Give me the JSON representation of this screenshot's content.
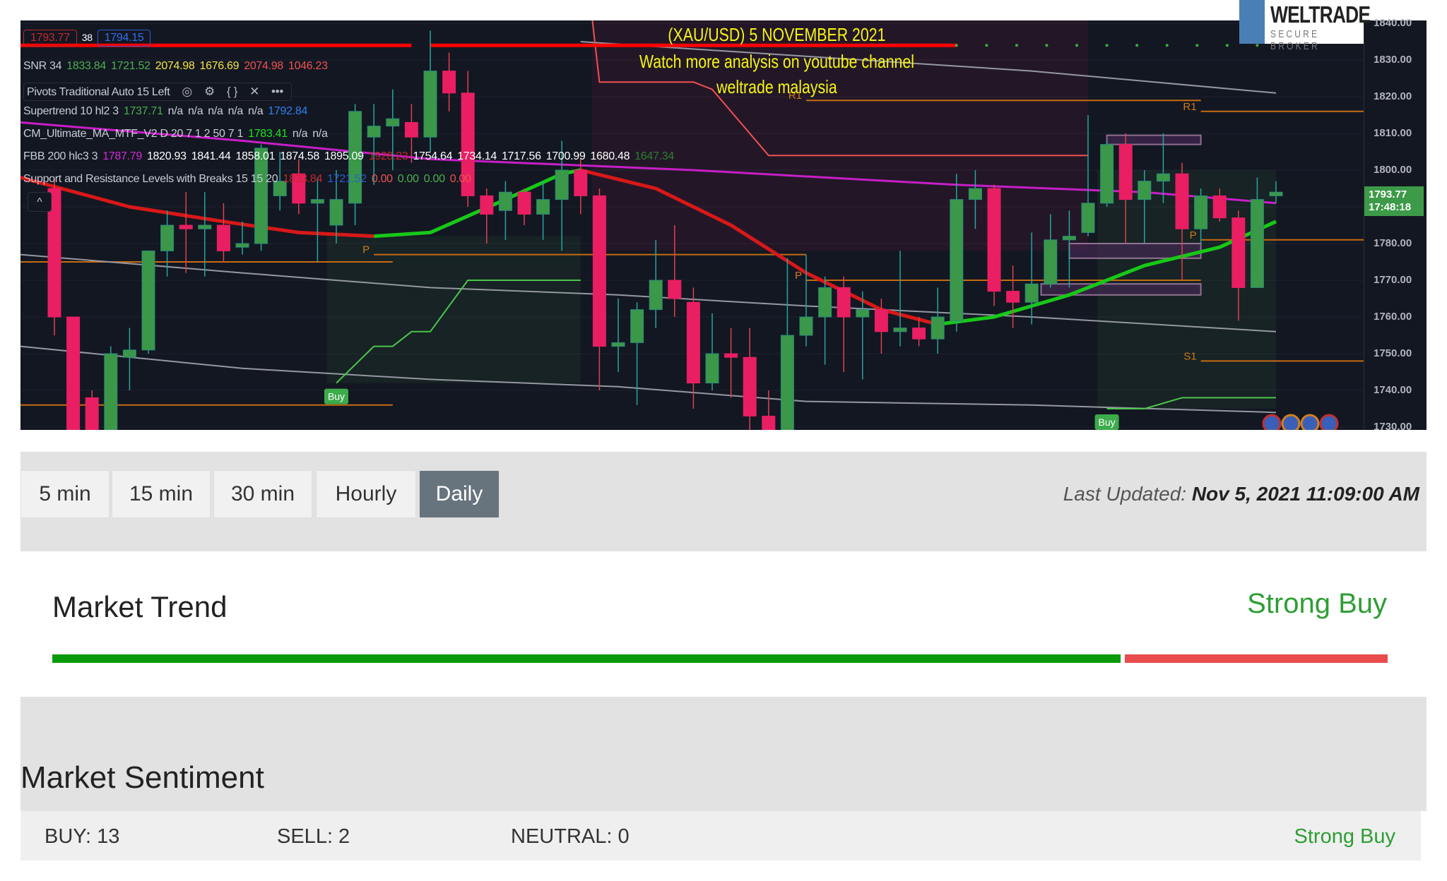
{
  "chart": {
    "title_lines": [
      "(XAU/USD) 5 NOVEMBER 2021",
      "Watch more analysis on youtube channel",
      "weltrade malaysia"
    ],
    "logo": {
      "name": "WELTRADE",
      "tagline": "SECURE BROKER"
    },
    "price_boxes": {
      "bid": "1793.77",
      "spread": "38",
      "ask": "1794.15"
    },
    "legend": [
      {
        "name": "SNR 34",
        "values": [
          {
            "t": "1833.84",
            "c": "#4caf50"
          },
          {
            "t": "1721.52",
            "c": "#4caf50"
          },
          {
            "t": "2074.98",
            "c": "#f5e642"
          },
          {
            "t": "1676.69",
            "c": "#f5e642"
          },
          {
            "t": "2074.98",
            "c": "#ef5350"
          },
          {
            "t": "1046.23",
            "c": "#ef5350"
          }
        ]
      },
      {
        "name": "Pivots Traditional Auto 15 Left",
        "values": [],
        "icons": [
          "eye-icon",
          "gear-icon",
          "source-code-icon",
          "close-icon",
          "more-icon"
        ]
      },
      {
        "name": "Supertrend 10 hl2 3",
        "values": [
          {
            "t": "1737.71",
            "c": "#4caf50"
          },
          {
            "t": "n/a",
            "c": "#c8ccd6"
          },
          {
            "t": "n/a",
            "c": "#c8ccd6"
          },
          {
            "t": "n/a",
            "c": "#c8ccd6"
          },
          {
            "t": "n/a",
            "c": "#c8ccd6"
          },
          {
            "t": "n/a",
            "c": "#c8ccd6"
          },
          {
            "t": "1792.84",
            "c": "#2f80ed"
          }
        ]
      },
      {
        "name": "CM_Ultimate_MA_MTF_V2 D 20 7 1 2 50 7 1",
        "values": [
          {
            "t": "1783.41",
            "c": "#19e619"
          },
          {
            "t": "n/a",
            "c": "#c8ccd6"
          },
          {
            "t": "n/a",
            "c": "#c8ccd6"
          }
        ]
      },
      {
        "name": "FBB 200 hlc3 3",
        "values": [
          {
            "t": "1787.79",
            "c": "#d42bd4"
          },
          {
            "t": "1820.93",
            "c": "#ffffff"
          },
          {
            "t": "1841.44",
            "c": "#ffffff"
          },
          {
            "t": "1858.01",
            "c": "#ffffff"
          },
          {
            "t": "1874.58",
            "c": "#ffffff"
          },
          {
            "t": "1895.09",
            "c": "#ffffff"
          },
          {
            "t": "1928.23",
            "c": "#c62828"
          },
          {
            "t": "1754.64",
            "c": "#ffffff"
          },
          {
            "t": "1734.14",
            "c": "#ffffff"
          },
          {
            "t": "1717.56",
            "c": "#ffffff"
          },
          {
            "t": "1700.99",
            "c": "#ffffff"
          },
          {
            "t": "1680.48",
            "c": "#ffffff"
          },
          {
            "t": "1647.34",
            "c": "#2e7d32"
          }
        ]
      },
      {
        "name": "Support and Resistance Levels with Breaks 15 15 20",
        "values": [
          {
            "t": "1833.84",
            "c": "#c62828"
          },
          {
            "t": "1721.52",
            "c": "#2f5fd0"
          },
          {
            "t": "0.00",
            "c": "#ef5350"
          },
          {
            "t": "0.00",
            "c": "#4caf50"
          },
          {
            "t": "0.00",
            "c": "#4caf50"
          },
          {
            "t": "0.00",
            "c": "#ef5350"
          }
        ]
      }
    ],
    "collapse_label": "^",
    "axis_labels": [
      "1840.00",
      "1830.00",
      "1820.00",
      "1810.00",
      "1800.00",
      "1790.00",
      "1780.00",
      "1770.00",
      "1760.00",
      "1750.00",
      "1740.00",
      "1730.00"
    ],
    "current_price": "1793.77",
    "countdown": "17:48:18",
    "buy_signal_label": "Buy",
    "pivot_labels": {
      "p": "P",
      "r1": "R1",
      "s1": "S1"
    },
    "colors": {
      "up": "#3a9848",
      "down": "#e91e63",
      "wick_up": "#26a69a",
      "wick_down": "#e04050",
      "background": "#131722"
    }
  },
  "chart_data": {
    "type": "candlestick",
    "symbol": "XAU/USD",
    "ylim": [
      1730,
      1840
    ],
    "candles_ohlc": [
      [
        1795,
        1798,
        1755,
        1760
      ],
      [
        1760,
        1760,
        1722,
        1725
      ],
      [
        1738,
        1740,
        1722,
        1728
      ],
      [
        1728,
        1752,
        1722,
        1750
      ],
      [
        1749,
        1757,
        1740,
        1751
      ],
      [
        1751,
        1778,
        1750,
        1778
      ],
      [
        1778,
        1789,
        1771,
        1785
      ],
      [
        1785,
        1794,
        1772,
        1784
      ],
      [
        1784,
        1794,
        1771,
        1785
      ],
      [
        1785,
        1791,
        1775,
        1778
      ],
      [
        1779,
        1786,
        1777,
        1780
      ],
      [
        1780,
        1807,
        1778,
        1806
      ],
      [
        1793,
        1805,
        1789,
        1797
      ],
      [
        1799,
        1803,
        1788,
        1791
      ],
      [
        1791,
        1798,
        1775,
        1792
      ],
      [
        1785,
        1800,
        1780,
        1792
      ],
      [
        1791,
        1818,
        1785,
        1816
      ],
      [
        1809,
        1818,
        1796,
        1812
      ],
      [
        1812,
        1822,
        1800,
        1814
      ],
      [
        1813,
        1818,
        1802,
        1809
      ],
      [
        1809,
        1838,
        1805,
        1827
      ],
      [
        1827,
        1832,
        1816,
        1821
      ],
      [
        1821,
        1827,
        1790,
        1793
      ],
      [
        1793,
        1795,
        1780,
        1788
      ],
      [
        1789,
        1797,
        1781,
        1794
      ],
      [
        1794,
        1795,
        1785,
        1788
      ],
      [
        1788,
        1797,
        1781,
        1792
      ],
      [
        1792,
        1808,
        1778,
        1800
      ],
      [
        1800,
        1803,
        1788,
        1793
      ],
      [
        1793,
        1795,
        1740,
        1752
      ],
      [
        1752,
        1765,
        1745,
        1753
      ],
      [
        1753,
        1764,
        1736,
        1762
      ],
      [
        1762,
        1781,
        1757,
        1770
      ],
      [
        1770,
        1785,
        1760,
        1765
      ],
      [
        1764,
        1768,
        1735,
        1742
      ],
      [
        1742,
        1761,
        1740,
        1750
      ],
      [
        1750,
        1757,
        1738,
        1749
      ],
      [
        1749,
        1757,
        1725,
        1733
      ],
      [
        1733,
        1740,
        1725,
        1728
      ],
      [
        1728,
        1776,
        1725,
        1755
      ],
      [
        1755,
        1777,
        1752,
        1760
      ],
      [
        1760,
        1771,
        1747,
        1768
      ],
      [
        1768,
        1771,
        1745,
        1760
      ],
      [
        1760,
        1767,
        1743,
        1762
      ],
      [
        1762,
        1765,
        1750,
        1756
      ],
      [
        1756,
        1778,
        1752,
        1757
      ],
      [
        1757,
        1760,
        1752,
        1754
      ],
      [
        1754,
        1768,
        1750,
        1760
      ],
      [
        1759,
        1799,
        1756,
        1792
      ],
      [
        1792,
        1800,
        1784,
        1795
      ],
      [
        1795,
        1796,
        1763,
        1767
      ],
      [
        1767,
        1774,
        1757,
        1764
      ],
      [
        1764,
        1783,
        1758,
        1769
      ],
      [
        1769,
        1788,
        1768,
        1781
      ],
      [
        1781,
        1789,
        1768,
        1782
      ],
      [
        1783,
        1815,
        1782,
        1791
      ],
      [
        1791,
        1808,
        1790,
        1807
      ],
      [
        1807,
        1810,
        1780,
        1792
      ],
      [
        1792,
        1800,
        1780,
        1797
      ],
      [
        1797,
        1810,
        1791,
        1799
      ],
      [
        1799,
        1802,
        1770,
        1784
      ],
      [
        1784,
        1795,
        1780,
        1793
      ],
      [
        1793,
        1795,
        1786,
        1787
      ],
      [
        1787,
        1789,
        1759,
        1768
      ],
      [
        1768,
        1798,
        1768,
        1792
      ],
      [
        1793,
        1797,
        1791,
        1794
      ]
    ],
    "overlays": {
      "fbb_upper": [
        [
          28,
          1835
        ],
        [
          40,
          1831
        ],
        [
          52,
          1827
        ],
        [
          65,
          1821
        ]
      ],
      "fbb_mid": [
        [
          -3,
          1777
        ],
        [
          10,
          1772
        ],
        [
          20,
          1768
        ],
        [
          30,
          1766
        ],
        [
          40,
          1763
        ],
        [
          52,
          1760
        ],
        [
          65,
          1756
        ]
      ],
      "fbb_lower": [
        [
          -3,
          1752
        ],
        [
          10,
          1746
        ],
        [
          20,
          1743
        ],
        [
          30,
          1741
        ],
        [
          40,
          1737
        ],
        [
          52,
          1736
        ],
        [
          65,
          1734
        ]
      ],
      "ma_magenta": [
        [
          -3,
          1813
        ],
        [
          10,
          1808
        ],
        [
          20,
          1803
        ],
        [
          34,
          1800
        ],
        [
          48,
          1796
        ],
        [
          58,
          1794
        ],
        [
          65,
          1791
        ]
      ],
      "trend_red_1": [
        [
          -3,
          1798
        ],
        [
          4,
          1790
        ],
        [
          9,
          1786
        ],
        [
          13,
          1783
        ],
        [
          17,
          1782
        ]
      ],
      "trend_green_1": [
        [
          17,
          1782
        ],
        [
          20,
          1783
        ],
        [
          24,
          1792
        ],
        [
          27,
          1799
        ],
        [
          28,
          1800
        ]
      ],
      "trend_red_2": [
        [
          28,
          1800
        ],
        [
          32,
          1795
        ],
        [
          36,
          1785
        ],
        [
          40,
          1772
        ],
        [
          44,
          1762
        ],
        [
          47,
          1758
        ]
      ],
      "trend_green_2": [
        [
          47,
          1758
        ],
        [
          50,
          1760
        ],
        [
          54,
          1766
        ],
        [
          58,
          1774
        ],
        [
          62,
          1779
        ],
        [
          65,
          1786
        ]
      ],
      "supertrend_down": [
        [
          28.6,
          1842
        ],
        [
          29,
          1824
        ],
        [
          34,
          1824
        ],
        [
          35,
          1822
        ],
        [
          38,
          1804
        ],
        [
          55,
          1804
        ]
      ],
      "supertrend_up_1": [
        [
          15,
          1742
        ],
        [
          17,
          1752
        ],
        [
          18,
          1752
        ],
        [
          19,
          1756
        ],
        [
          20,
          1756
        ],
        [
          22,
          1770
        ],
        [
          28,
          1770
        ]
      ],
      "supertrend_up_2": [
        [
          56,
          1735
        ],
        [
          58,
          1735
        ],
        [
          60,
          1738
        ],
        [
          65,
          1738
        ]
      ],
      "resistance_line": [
        [
          -3,
          1834
        ],
        [
          19,
          1834
        ]
      ],
      "resistance_line_2": [
        [
          20,
          1834
        ],
        [
          48,
          1834
        ]
      ]
    },
    "levels": [
      {
        "label": "",
        "price": 1775,
        "from": -3,
        "to": 18
      },
      {
        "label": "P",
        "price": 1777,
        "from": 17,
        "to": 40
      },
      {
        "label": "",
        "price": 1736,
        "from": -3,
        "to": 18
      },
      {
        "label": "R1",
        "price": 1819,
        "from": 40,
        "to": 61
      },
      {
        "label": "P",
        "price": 1770,
        "from": 40,
        "to": 61
      },
      {
        "label": "R1",
        "price": 1816,
        "from": 61,
        "to": 70
      },
      {
        "label": "P",
        "price": 1781,
        "from": 61,
        "to": 70
      },
      {
        "label": "S1",
        "price": 1748,
        "from": 61,
        "to": 70
      }
    ],
    "zones": [
      [
        56,
        61,
        1809.5,
        1807
      ],
      [
        54,
        61,
        1780,
        1776
      ],
      [
        52.5,
        61,
        1769,
        1766
      ]
    ],
    "buy_signals": [
      [
        15,
        1742
      ],
      [
        56,
        1735
      ]
    ]
  },
  "timeframes": {
    "tabs": [
      "5 min",
      "15 min",
      "30 min",
      "Hourly",
      "Daily"
    ],
    "active": "Daily",
    "last_updated_label": "Last Updated:",
    "last_updated_value": "Nov 5, 2021 11:09:00 AM"
  },
  "market_trend": {
    "title": "Market Trend",
    "value": "Strong Buy",
    "buy_fraction": 0.8,
    "colors": {
      "buy": "#0a9a0a",
      "sell": "#e84c4c",
      "label": "#2e9e34"
    }
  },
  "market_sentiment": {
    "title": "Market Sentiment",
    "buy": "BUY: 13",
    "sell": "SELL: 2",
    "neutral": "NEUTRAL: 0",
    "value": "Strong Buy"
  }
}
